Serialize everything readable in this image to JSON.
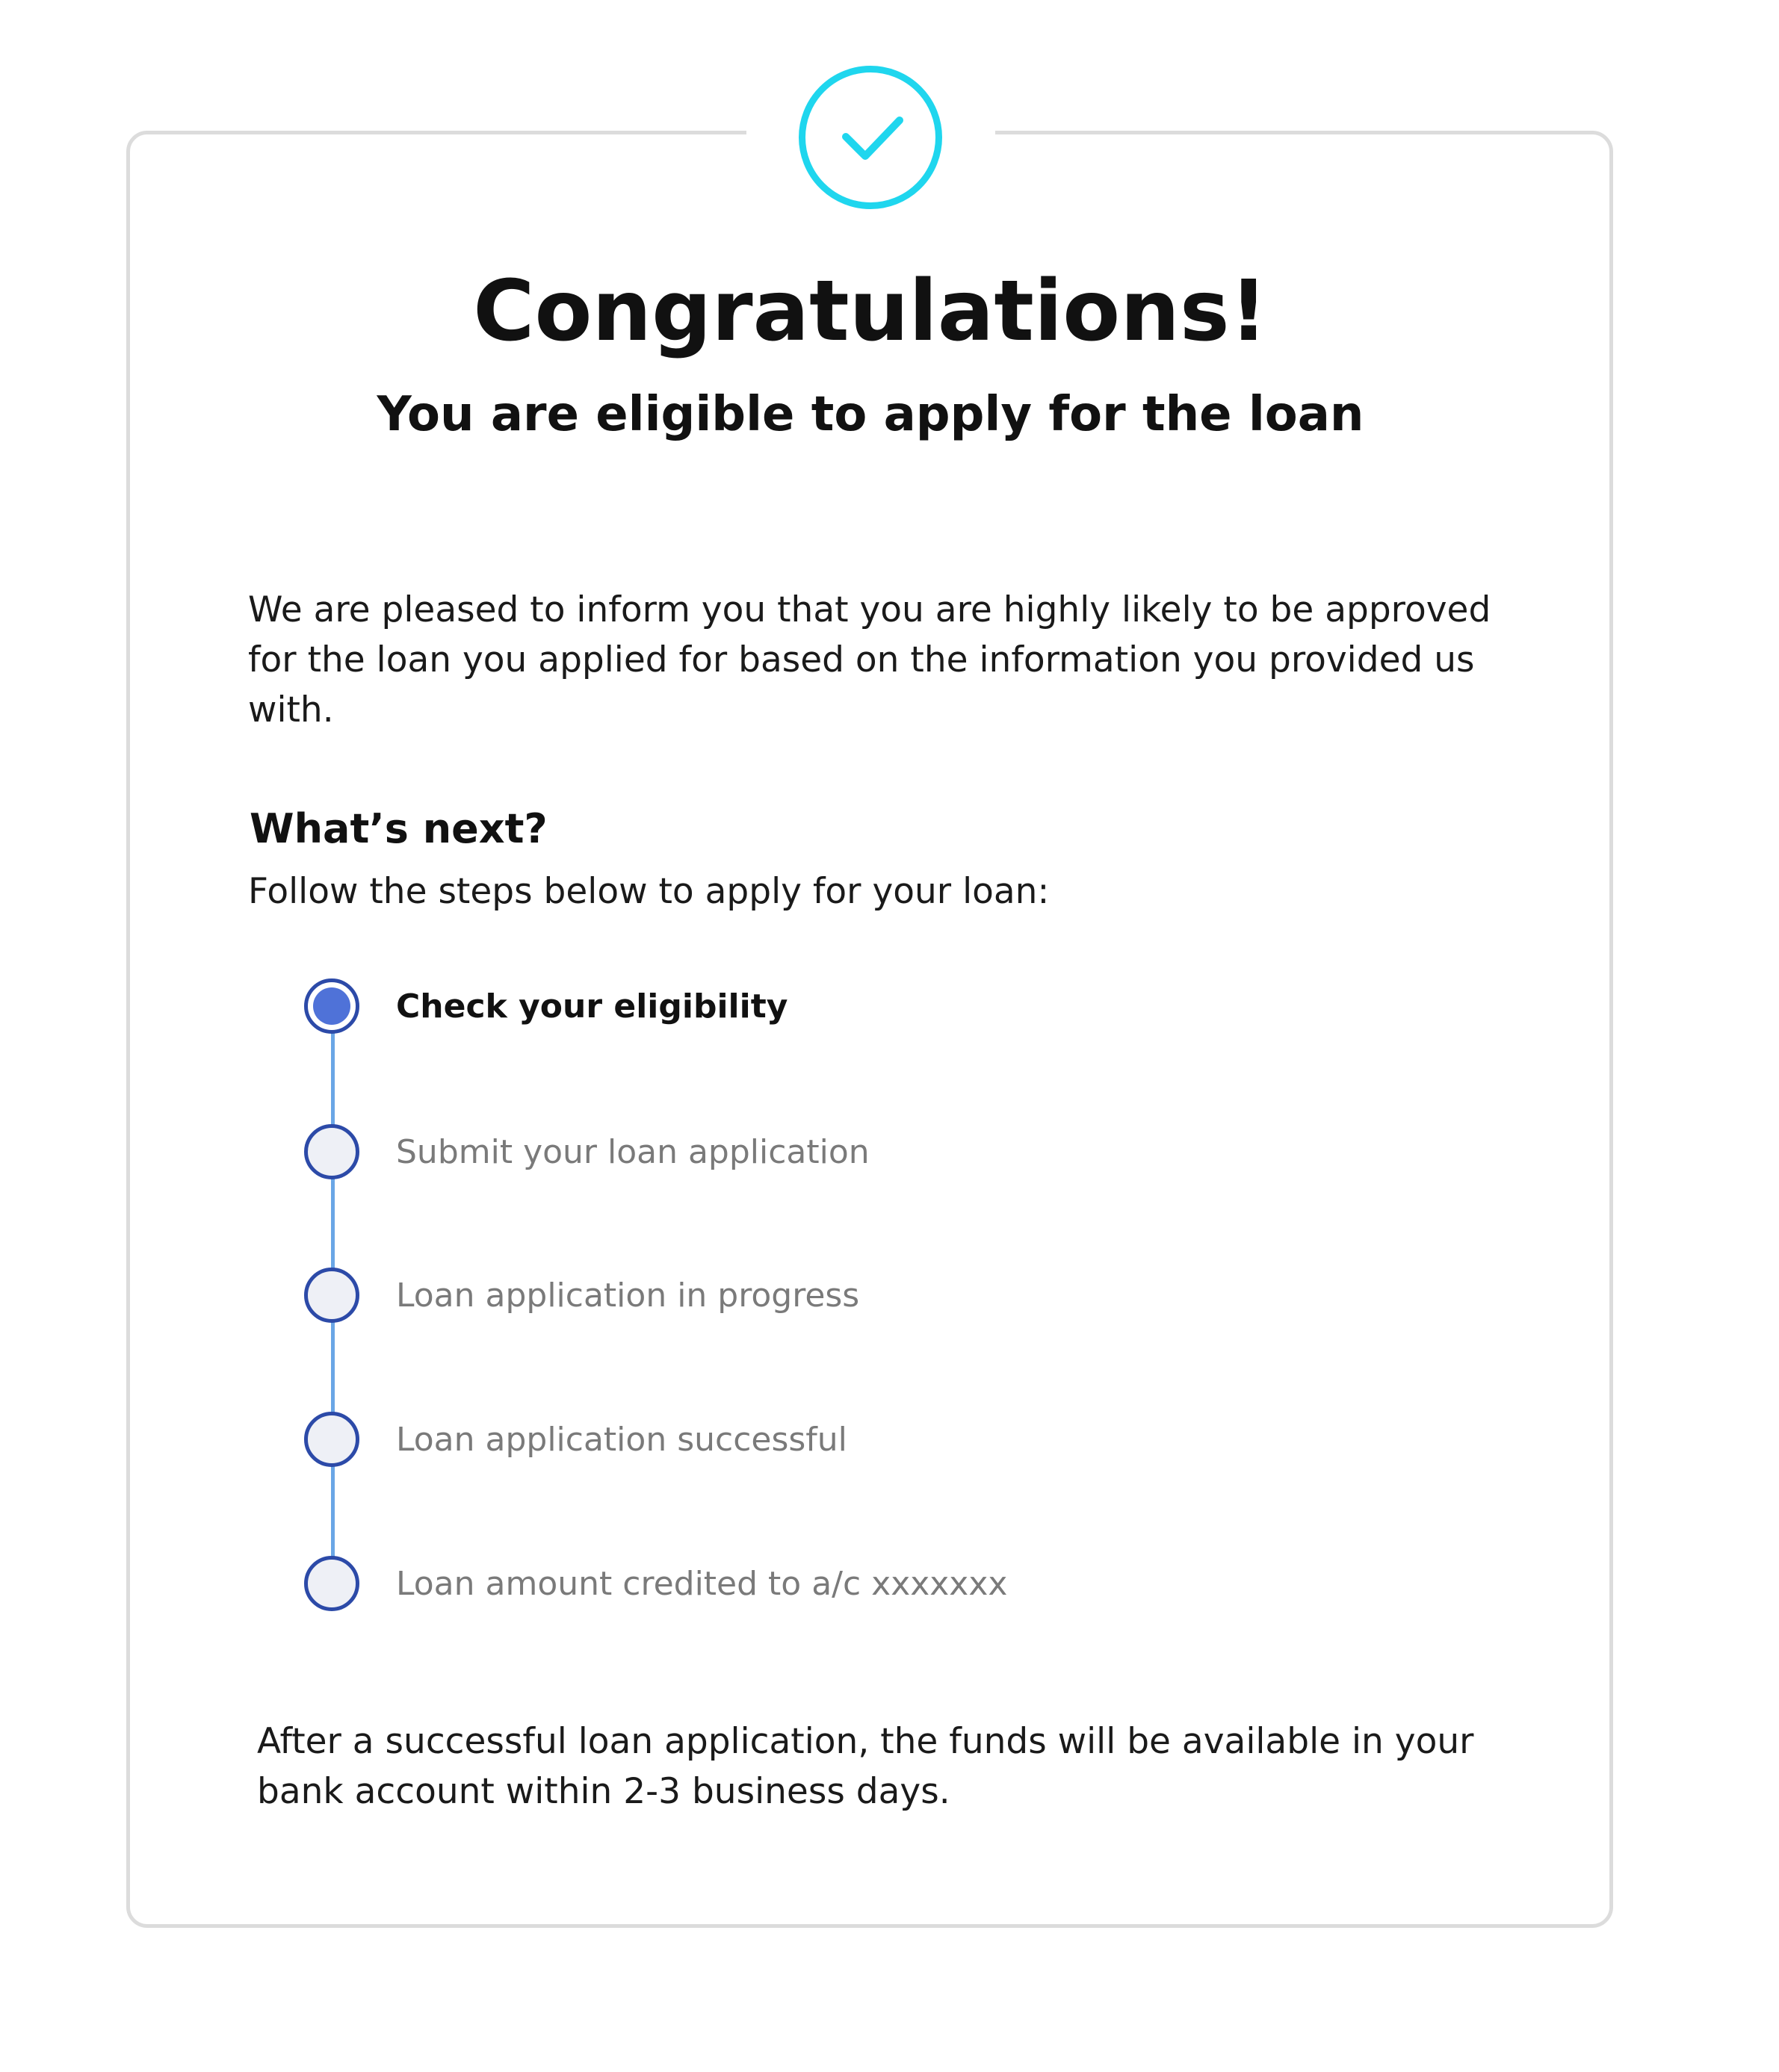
{
  "header": {
    "icon": "check-circle-icon",
    "accent_color": "#1fd6ee",
    "title": "Congratulations!",
    "subtitle": "You are eligible to apply for the loan"
  },
  "intro": {
    "text": "We are pleased to inform you that you are highly likely to be approved for the loan you applied for based on the information you provided us with."
  },
  "next": {
    "heading": "What’s next?",
    "subheading": "Follow the steps below to apply for your loan:"
  },
  "steps": [
    {
      "label": "Check your eligibility",
      "state": "active"
    },
    {
      "label": "Submit your loan application",
      "state": "pending"
    },
    {
      "label": "Loan application in progress",
      "state": "pending"
    },
    {
      "label": "Loan application successful",
      "state": "pending"
    },
    {
      "label": "Loan amount credited to a/c xxxxxxx",
      "state": "pending"
    }
  ],
  "colors": {
    "step_active": "#4f72d8",
    "step_border": "#2c4aa8",
    "step_line": "#6aa6e6",
    "pending_text": "#7a7a7a"
  },
  "footer": {
    "text": "After a successful loan application, the funds will be available in your bank account within 2-3 business days."
  }
}
